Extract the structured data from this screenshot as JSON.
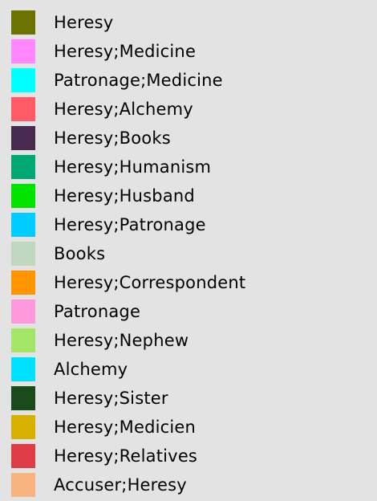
{
  "legend": {
    "items": [
      {
        "label": "Heresy",
        "color": "#6b7200"
      },
      {
        "label": "Heresy;Medicine",
        "color": "#ff88ff"
      },
      {
        "label": "Patronage;Medicine",
        "color": "#00ffff"
      },
      {
        "label": "Heresy;Alchemy",
        "color": "#ff5a66"
      },
      {
        "label": "Heresy;Books",
        "color": "#47294f"
      },
      {
        "label": "Heresy;Humanism",
        "color": "#00a874"
      },
      {
        "label": "Heresy;Husband",
        "color": "#00e400"
      },
      {
        "label": "Heresy;Patronage",
        "color": "#00ccff"
      },
      {
        "label": "Books",
        "color": "#c0d8c0"
      },
      {
        "label": "Heresy;Correspondent",
        "color": "#ff9500"
      },
      {
        "label": "Patronage",
        "color": "#ff99dd"
      },
      {
        "label": "Heresy;Nephew",
        "color": "#a3e566"
      },
      {
        "label": "Alchemy",
        "color": "#00e0ff"
      },
      {
        "label": "Heresy;Sister",
        "color": "#184a1a"
      },
      {
        "label": "Heresy;Medicien",
        "color": "#d8b000"
      },
      {
        "label": "Heresy;Relatives",
        "color": "#de3c46"
      },
      {
        "label": "Accuser;Heresy",
        "color": "#f7b380"
      }
    ]
  }
}
